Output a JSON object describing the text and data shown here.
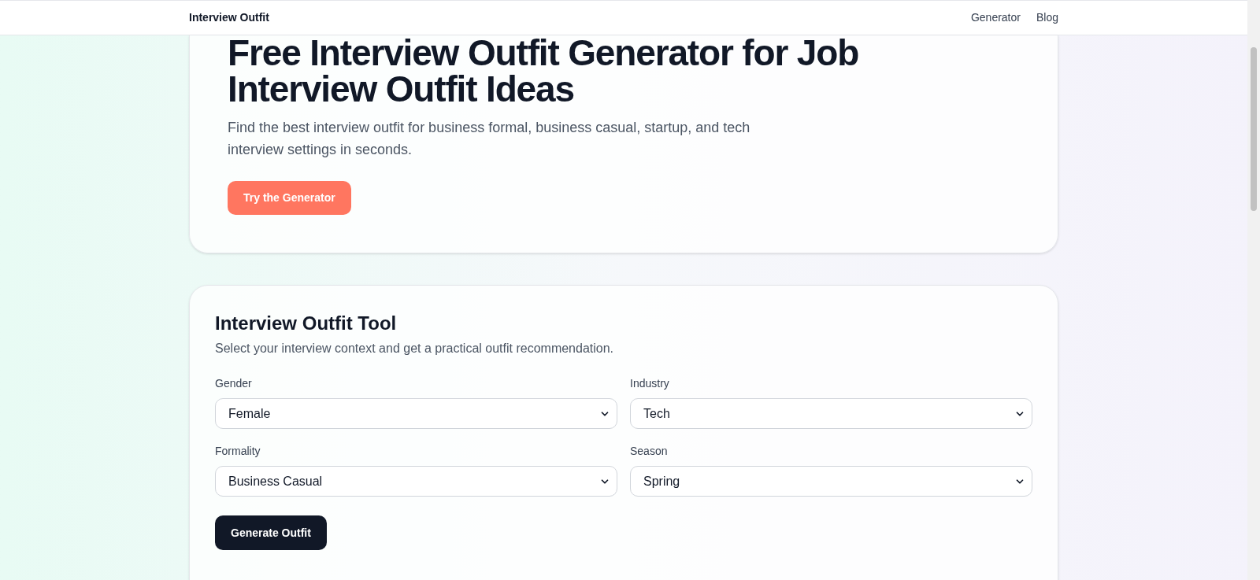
{
  "header": {
    "brand": "Interview Outfit",
    "nav": [
      {
        "label": "Generator"
      },
      {
        "label": "Blog"
      }
    ]
  },
  "hero": {
    "title": "Free Interview Outfit Generator for Job Interview Outfit Ideas",
    "description": "Find the best interview outfit for business formal, business casual, startup, and tech interview settings in seconds.",
    "button": "Try the Generator"
  },
  "tool": {
    "title": "Interview Outfit Tool",
    "subtitle": "Select your interview context and get a practical outfit recommendation.",
    "fields": [
      {
        "label": "Gender",
        "value": "Female"
      },
      {
        "label": "Industry",
        "value": "Tech"
      },
      {
        "label": "Formality",
        "value": "Business Casual"
      },
      {
        "label": "Season",
        "value": "Spring"
      }
    ],
    "button": "Generate Outfit"
  }
}
